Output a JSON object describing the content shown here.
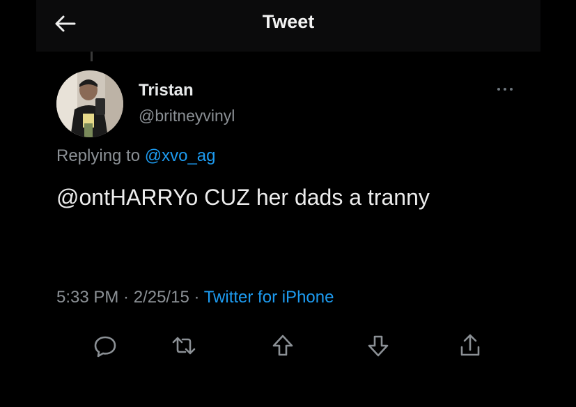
{
  "header": {
    "title": "Tweet",
    "back_icon": "arrow-left-icon"
  },
  "tweet": {
    "author_name": "Tristan",
    "author_handle": "@britneyvinyl",
    "replying_prefix": "Replying to ",
    "replying_to": "@xvo_ag",
    "text": "@ontHARRYo CUZ her dads a tranny",
    "time": "5:33 PM",
    "date": "2/25/15",
    "separator": " · ",
    "source": "Twitter for iPhone"
  },
  "actions": [
    {
      "name": "reply",
      "icon": "comment-icon"
    },
    {
      "name": "retweet",
      "icon": "retweet-icon"
    },
    {
      "name": "upvote",
      "icon": "upvote-icon"
    },
    {
      "name": "downvote",
      "icon": "downvote-icon"
    },
    {
      "name": "share",
      "icon": "share-icon"
    }
  ],
  "colors": {
    "background": "#000000",
    "header_bg": "#0b0b0c",
    "text": "#e7e9ea",
    "secondary": "#8b9095",
    "link": "#1d9bf0"
  }
}
